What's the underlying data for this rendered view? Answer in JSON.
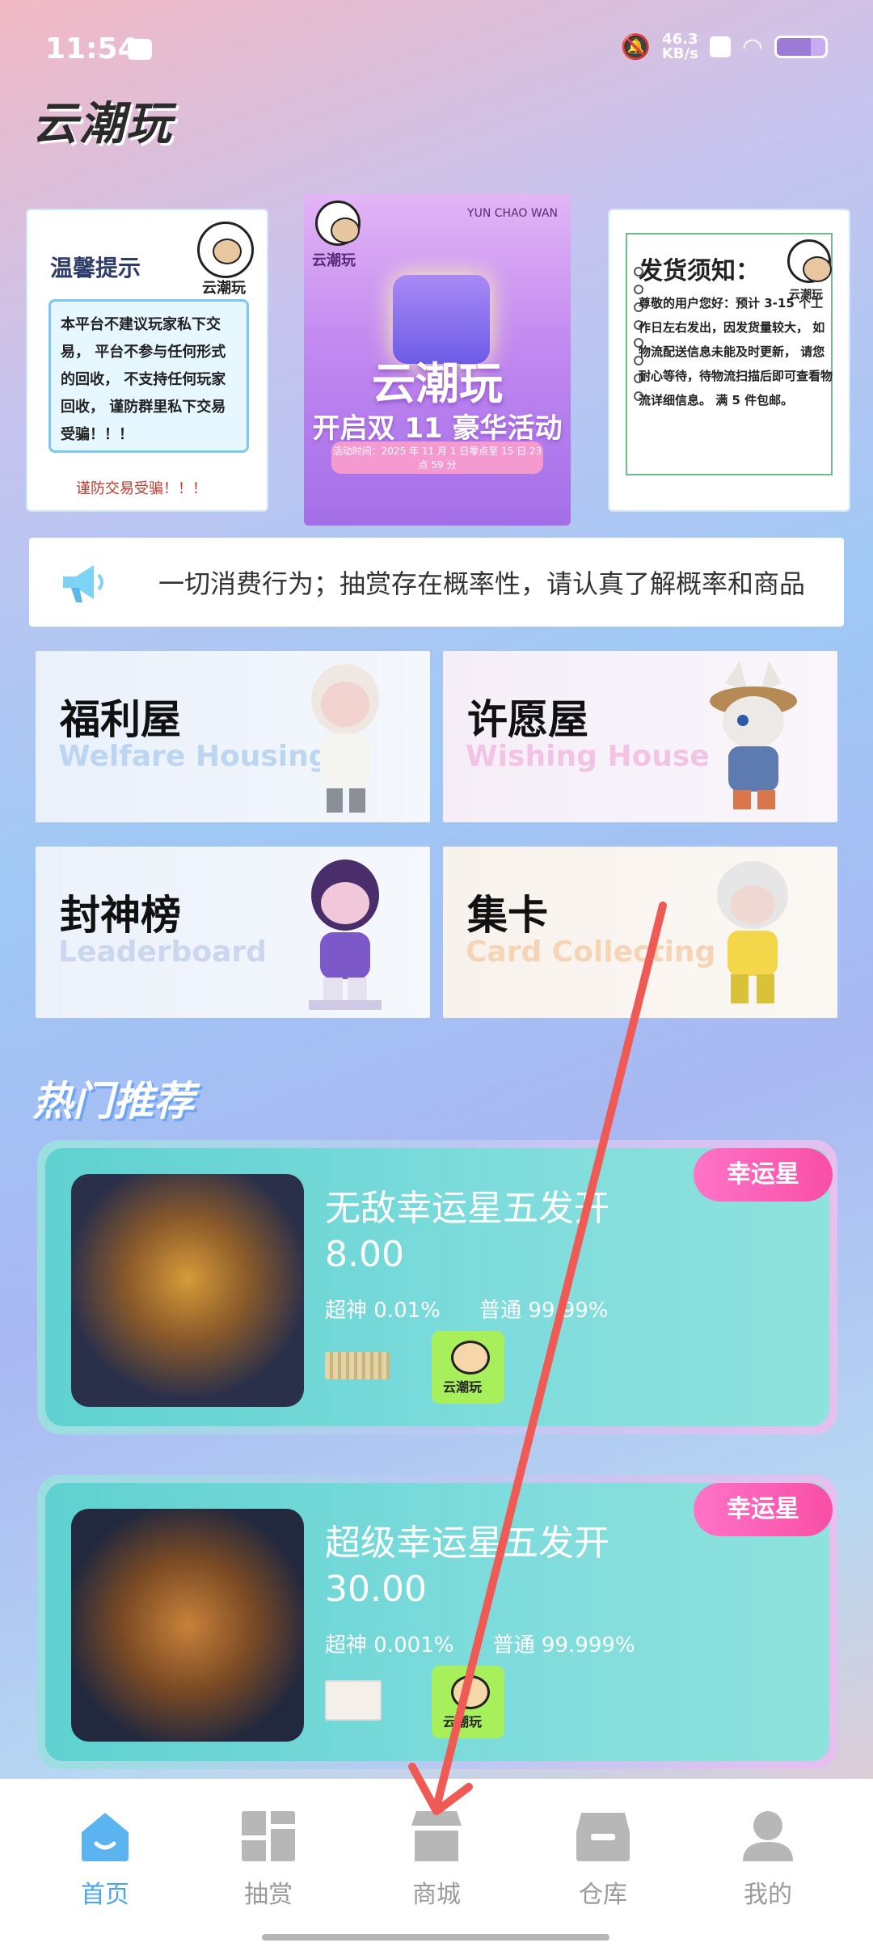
{
  "status_bar": {
    "time": "11:54",
    "speed_value": "46.3",
    "speed_unit": "KB/s"
  },
  "app": {
    "logo_text": "云潮玩"
  },
  "banners": {
    "left": {
      "title": "温馨提示",
      "brand": "云潮玩",
      "body": "本平台不建议玩家私下交易， 平台不参与任何形式的回收， 不支持任何玩家回收， 谨防群里私下交易受骗！！！",
      "footer": "谨防交易受骗！！！"
    },
    "middle": {
      "brand_en": "YUN CHAO WAN",
      "brand_cn": "云潮玩",
      "headline": "云潮玩",
      "subline": "开启双 11 豪华活动",
      "date_text": "活动时间：2025 年 11 月 1 日零点至 15 日 23 点 59 分"
    },
    "right": {
      "title": "发货须知：",
      "brand": "云潮玩",
      "body": "尊敬的用户您好：预计 3-15 个工作日左右发出，因发货量较大， 如物流配送信息未能及时更新， 请您耐心等待，待物流扫描后即可查看物流详细信息。 满 5 件包邮。"
    }
  },
  "notice": {
    "text": "一切消费行为；抽赏存在概率性，请认真了解概率和商品"
  },
  "features": [
    {
      "title": "福利屋",
      "subtitle": "Welfare Housing"
    },
    {
      "title": "许愿屋",
      "subtitle": "Wishing House"
    },
    {
      "title": "封神榜",
      "subtitle": "Leaderboard"
    },
    {
      "title": "集卡",
      "subtitle": "Card Collecting"
    }
  ],
  "section": {
    "title": "热门推荐"
  },
  "products": [
    {
      "name": "无敌幸运星五发开",
      "price": "8.00",
      "odds_top": "超神 0.01%",
      "odds_normal": "普通 99.99%",
      "tag": "幸运星",
      "brand": "云潮玩"
    },
    {
      "name": "超级幸运星五发开",
      "price": "30.00",
      "odds_top": "超神 0.001%",
      "odds_normal": "普通 99.999%",
      "tag": "幸运星",
      "brand": "云潮玩"
    }
  ],
  "tabbar": {
    "items": [
      {
        "label": "首页",
        "icon": "home-icon",
        "active": true
      },
      {
        "label": "抽赏",
        "icon": "grid-icon",
        "active": false
      },
      {
        "label": "商城",
        "icon": "store-icon",
        "active": false
      },
      {
        "label": "仓库",
        "icon": "warehouse-icon",
        "active": false
      },
      {
        "label": "我的",
        "icon": "profile-icon",
        "active": false
      }
    ]
  },
  "colors": {
    "accent": "#4aa6ea",
    "tag_pink": "#f84fa5",
    "card_teal": "#5fd1d0",
    "annotation_arrow": "#ef5a55"
  }
}
